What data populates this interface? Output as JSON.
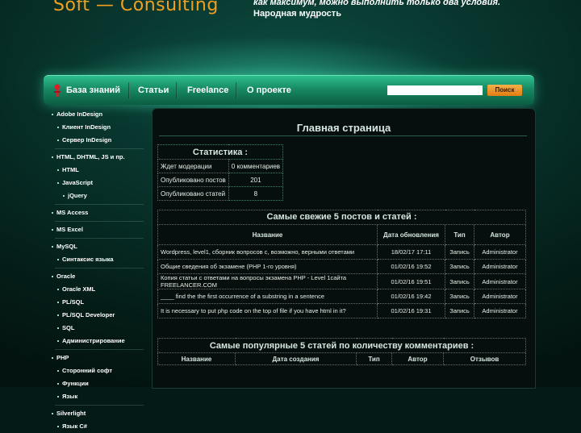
{
  "header": {
    "logo": "Soft — Consulting",
    "motto_line1": "как максимум, можно выполнить только два условия.",
    "motto_line2": "Народная мудрость"
  },
  "nav": {
    "items": [
      "База знаний",
      "Статьи",
      "Freelance",
      "О проекте"
    ],
    "search_placeholder": "",
    "search_button": "Поиск"
  },
  "sidebar": {
    "items": [
      {
        "label": "Adobe InDesign",
        "level": 0
      },
      {
        "label": "Клиент InDesign",
        "level": 1
      },
      {
        "label": "Сервер InDesign",
        "level": 1
      },
      {
        "label": "HTML, DHTML, JS и пр.",
        "level": 0
      },
      {
        "label": "HTML",
        "level": 1
      },
      {
        "label": "JavaScript",
        "level": 1
      },
      {
        "label": "jQuery",
        "level": 2
      },
      {
        "label": "MS Access",
        "level": 0
      },
      {
        "label": "MS Excel",
        "level": 0
      },
      {
        "label": "MySQL",
        "level": 0
      },
      {
        "label": "Синтаксис языка",
        "level": 1
      },
      {
        "label": "Oracle",
        "level": 0
      },
      {
        "label": "Oracle XML",
        "level": 1
      },
      {
        "label": "PL/SQL",
        "level": 1
      },
      {
        "label": "PL/SQL Developer",
        "level": 1
      },
      {
        "label": "SQL",
        "level": 1
      },
      {
        "label": "Администрирование",
        "level": 1
      },
      {
        "label": "PHP",
        "level": 0
      },
      {
        "label": "Сторонний софт",
        "level": 1
      },
      {
        "label": "Функции",
        "level": 1
      },
      {
        "label": "Язык",
        "level": 1
      },
      {
        "label": "Silverlight",
        "level": 0
      },
      {
        "label": "Язык C#",
        "level": 1
      }
    ]
  },
  "main": {
    "title": "Главная страница",
    "stats": {
      "title": "Статистика :",
      "rows": [
        {
          "label": "Ждет модерации",
          "value": "0 комментариев"
        },
        {
          "label": "Опубликовано постов",
          "value": "201"
        },
        {
          "label": "Опубликовано статей",
          "value": "8"
        }
      ]
    },
    "fresh": {
      "title": "Самые свежие 5 постов и статей :",
      "columns": [
        "Название",
        "Дата обновления",
        "Тип",
        "Автор"
      ],
      "rows": [
        {
          "title": "Wordpress, level1, сборник вопросов с, возможно, верными ответами",
          "date": "18/02/17 17:11",
          "type": "Запись",
          "author": "Administrator"
        },
        {
          "title": "Общие сведения об экзамене (PHP 1-го уровня)",
          "date": "01/02/16 19:52",
          "type": "Запись",
          "author": "Administrator"
        },
        {
          "title": "Копия статьи с ответами на вопросы экзамена PHP - Level 1сайта FREELANCER.COM",
          "date": "01/02/16 19:51",
          "type": "Запись",
          "author": "Administrator"
        },
        {
          "title": "____ find the the first occurrence of a substring in a sentence",
          "date": "01/02/16 19:42",
          "type": "Запись",
          "author": "Administrator"
        },
        {
          "title": "It is necessary to put php code on the top of file if you have html in it?",
          "date": "01/02/16 19:31",
          "type": "Запись",
          "author": "Administrator"
        }
      ]
    },
    "popular": {
      "title": "Самые популярные 5 статей по количеству комментариев :",
      "columns": [
        "Название",
        "Дата создания",
        "Тип",
        "Автор",
        "Отзывов"
      ]
    }
  }
}
